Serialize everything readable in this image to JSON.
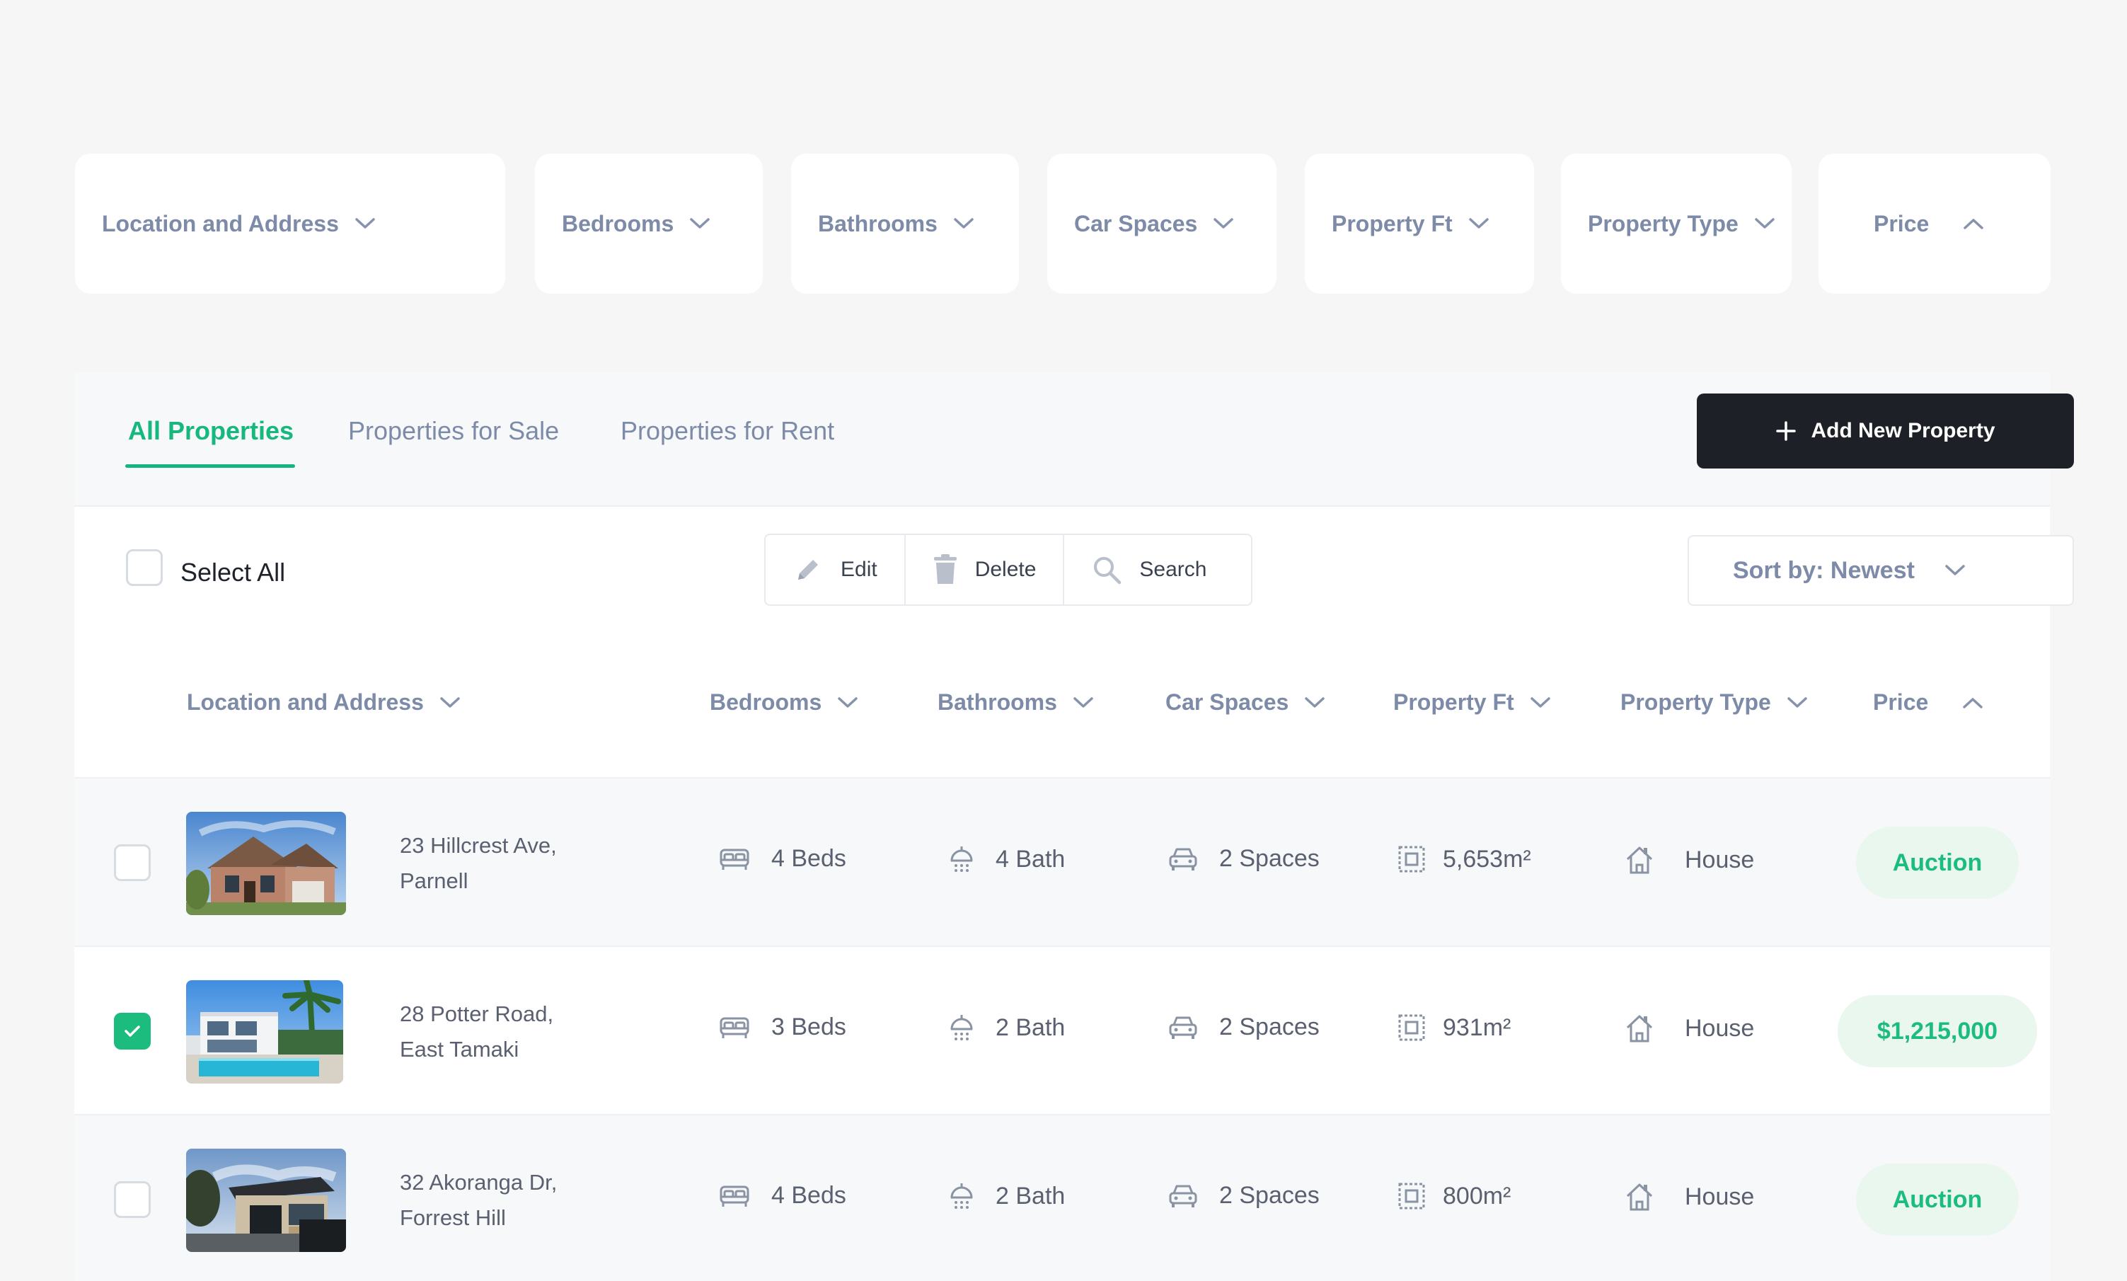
{
  "filters": [
    {
      "label": "Location and Address",
      "icon": "chevron-down-icon"
    },
    {
      "label": "Bedrooms",
      "icon": "chevron-down-icon"
    },
    {
      "label": "Bathrooms",
      "icon": "chevron-down-icon"
    },
    {
      "label": "Car Spaces",
      "icon": "chevron-down-icon"
    },
    {
      "label": "Property Ft",
      "icon": "chevron-down-icon"
    },
    {
      "label": "Property Type",
      "icon": "chevron-down-icon"
    },
    {
      "label": "Price",
      "icon": "chevron-up-icon"
    }
  ],
  "tabs": [
    {
      "label": "All Properties",
      "active": true
    },
    {
      "label": "Properties for Sale",
      "active": false
    },
    {
      "label": "Properties for Rent",
      "active": false
    }
  ],
  "add_button": {
    "label": "Add New Property",
    "icon": "plus-icon"
  },
  "toolbar": {
    "select_all": "Select All",
    "edit": "Edit",
    "delete": "Delete",
    "search": "Search",
    "sort": "Sort by: Newest"
  },
  "columns": [
    {
      "label": "Location and Address",
      "icon": "chevron-down-icon"
    },
    {
      "label": "Bedrooms",
      "icon": "chevron-down-icon"
    },
    {
      "label": "Bathrooms",
      "icon": "chevron-down-icon"
    },
    {
      "label": "Car Spaces",
      "icon": "chevron-down-icon"
    },
    {
      "label": "Property Ft",
      "icon": "chevron-down-icon"
    },
    {
      "label": "Property Type",
      "icon": "chevron-down-icon"
    },
    {
      "label": "Price",
      "icon": "chevron-up-icon"
    }
  ],
  "rows": [
    {
      "address_line1": "23 Hillcrest Ave,",
      "address_line2": "Parnell",
      "beds": "4 Beds",
      "baths": "4 Bath",
      "spaces": "2 Spaces",
      "area": "5,653m²",
      "type": "House",
      "price": "Auction",
      "checked": false
    },
    {
      "address_line1": "28 Potter Road,",
      "address_line2": "East Tamaki",
      "beds": "3 Beds",
      "baths": "2 Bath",
      "spaces": "2 Spaces",
      "area": "931m²",
      "type": "House",
      "price": "$1,215,000",
      "checked": true
    },
    {
      "address_line1": "32 Akoranga Dr,",
      "address_line2": "Forrest Hill",
      "beds": "4 Beds",
      "baths": "2 Bath",
      "spaces": "2 Spaces",
      "area": "800m²",
      "type": "House",
      "price": "Auction",
      "checked": false
    }
  ],
  "colors": {
    "accent_green": "#1cbb7e",
    "pill_bg": "#e9f7ef",
    "dark_button": "#1d2127",
    "muted_text": "#7d8aa8"
  }
}
